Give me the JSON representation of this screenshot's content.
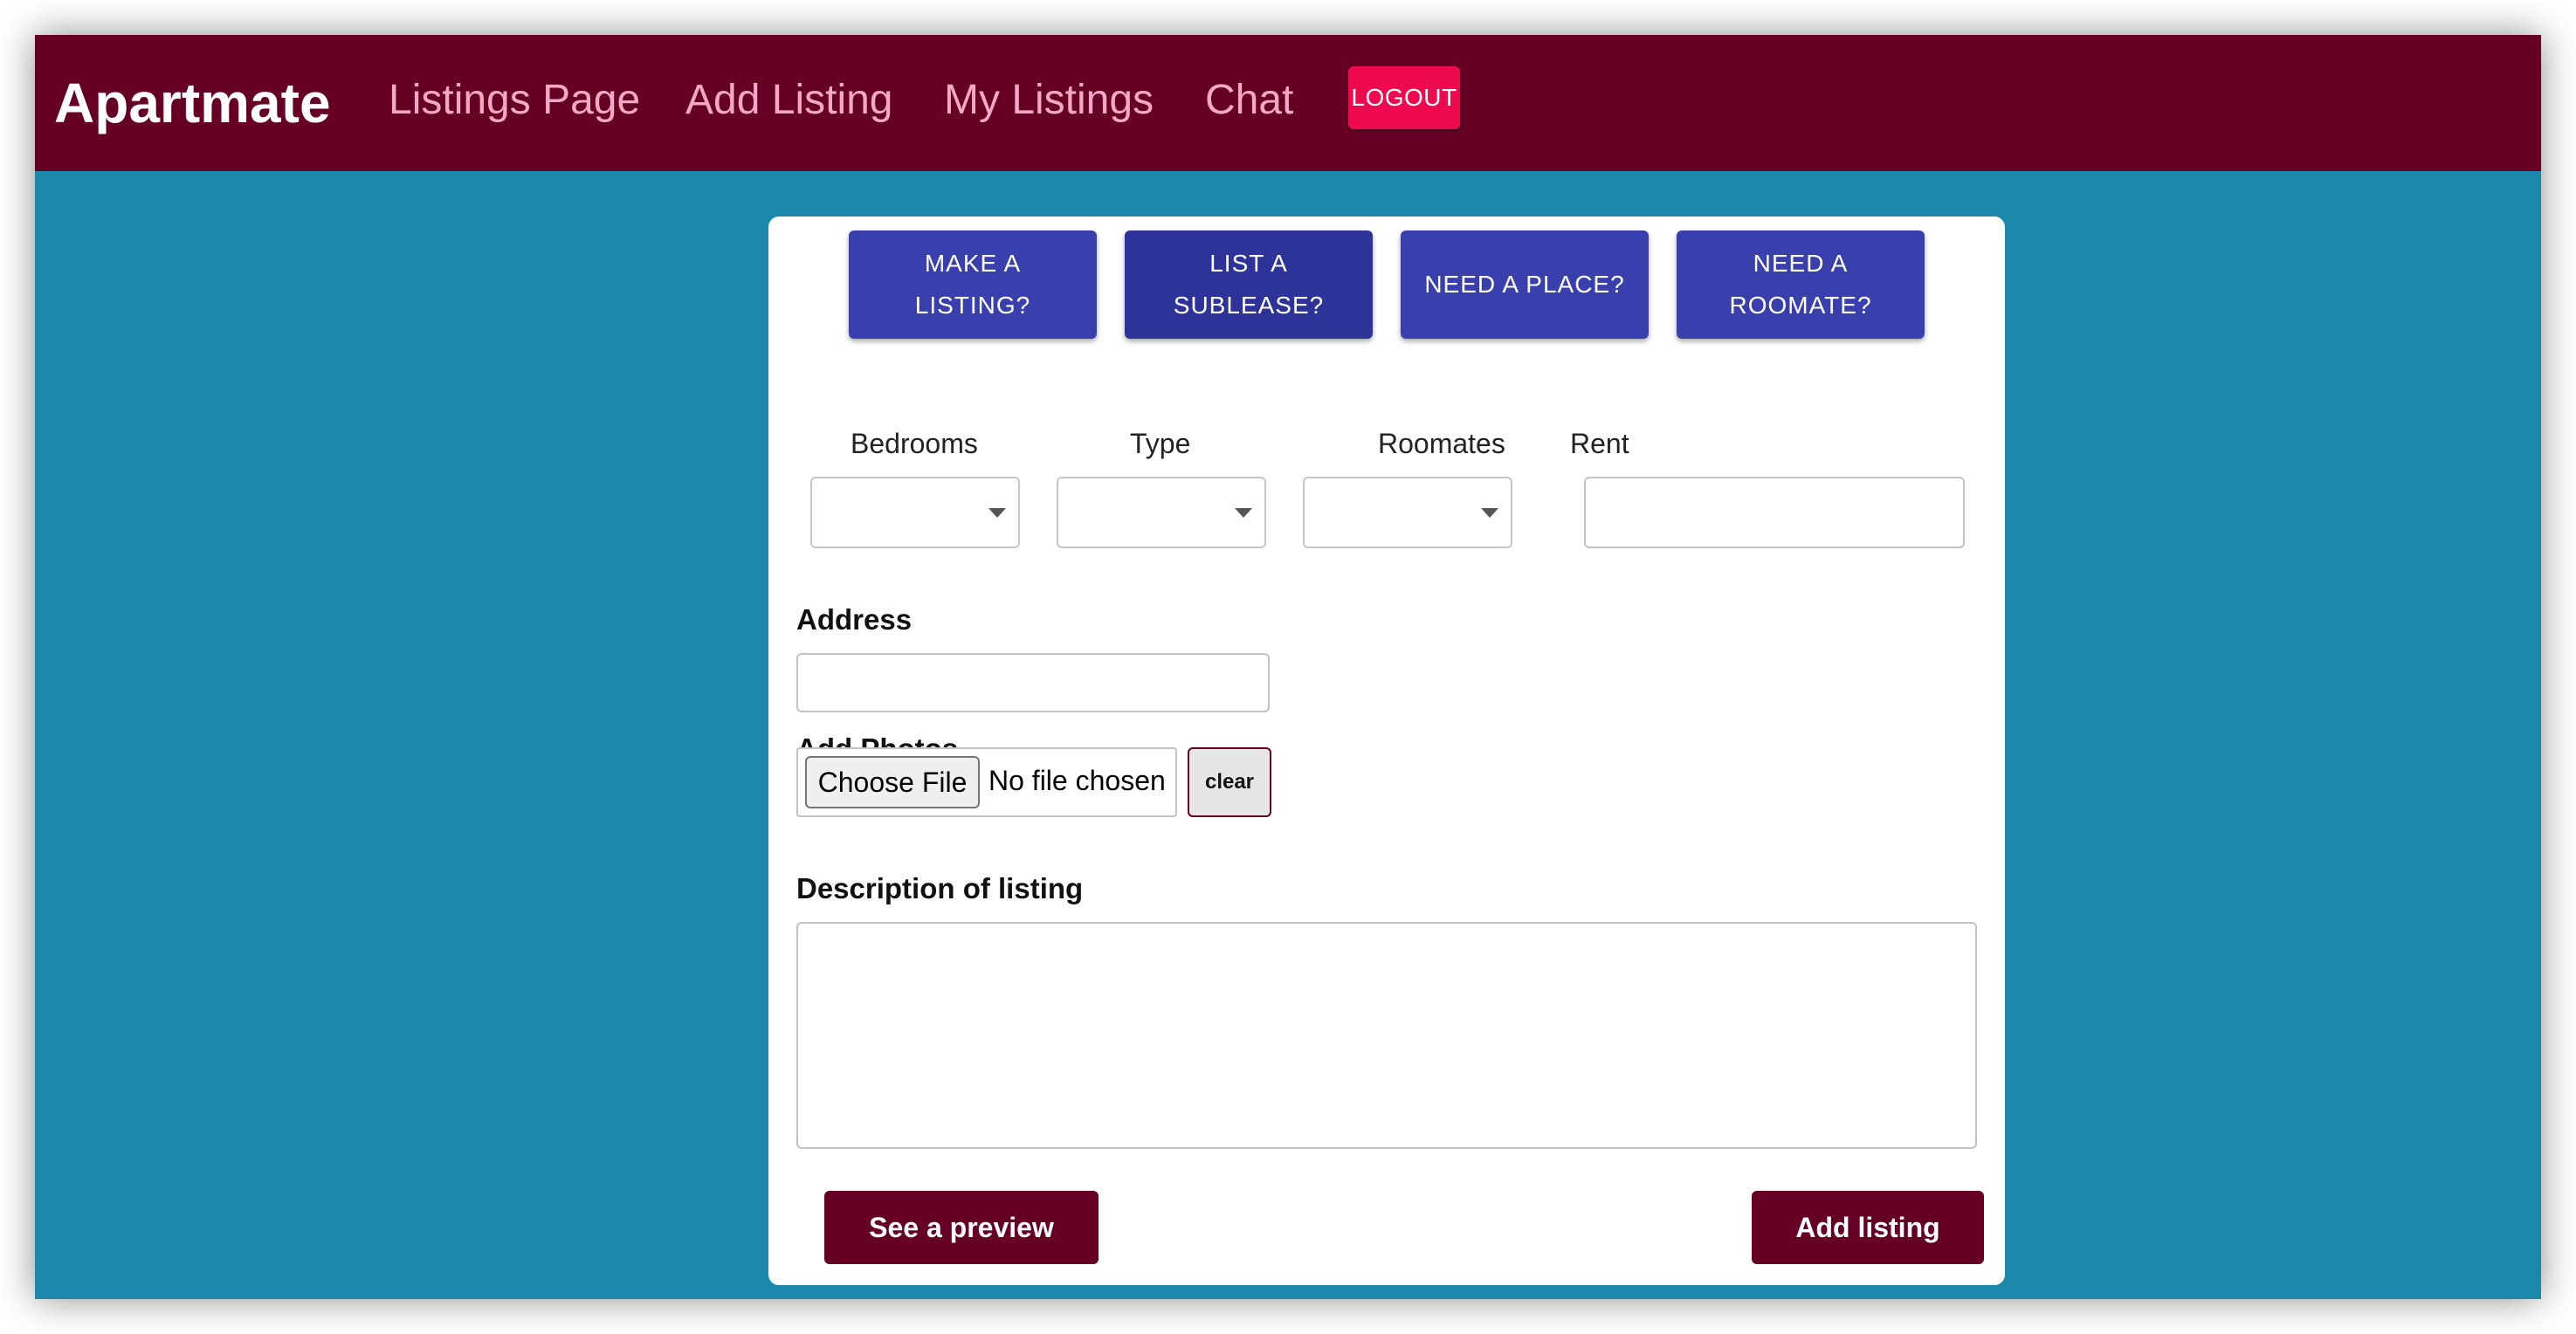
{
  "navbar": {
    "brand": "Apartmate",
    "links": [
      "Listings Page",
      "Add Listing",
      "My Listings",
      "Chat"
    ],
    "logout_label": "LOGOUT"
  },
  "mode_buttons": [
    {
      "label": "MAKE A LISTING?",
      "active": false
    },
    {
      "label": "LIST A SUBLEASE?",
      "active": true
    },
    {
      "label": "NEED A PLACE?",
      "active": false
    },
    {
      "label": "NEED A ROOMATE?",
      "active": false
    }
  ],
  "form": {
    "bedrooms_label": "Bedrooms",
    "type_label": "Type",
    "roomates_label": "Roomates",
    "rent_label": "Rent",
    "bedrooms_value": "",
    "type_value": "",
    "roomates_value": "",
    "rent_value": "",
    "address_label": "Address",
    "address_value": "",
    "photos_label": "Add Photos",
    "choose_file_label": "Choose File",
    "no_file_text": "No file chosen",
    "clear_label": "clear",
    "description_label": "Description of listing",
    "description_value": "",
    "preview_label": "See a preview",
    "submit_label": "Add listing"
  },
  "colors": {
    "navbar_bg": "#650024",
    "nav_link": "#f4a8c6",
    "logout_bg": "#ee0a4f",
    "page_bg": "#1a87ab",
    "mode_button": "#3940ae",
    "mode_button_active": "#2d3398",
    "action_button": "#650024"
  }
}
